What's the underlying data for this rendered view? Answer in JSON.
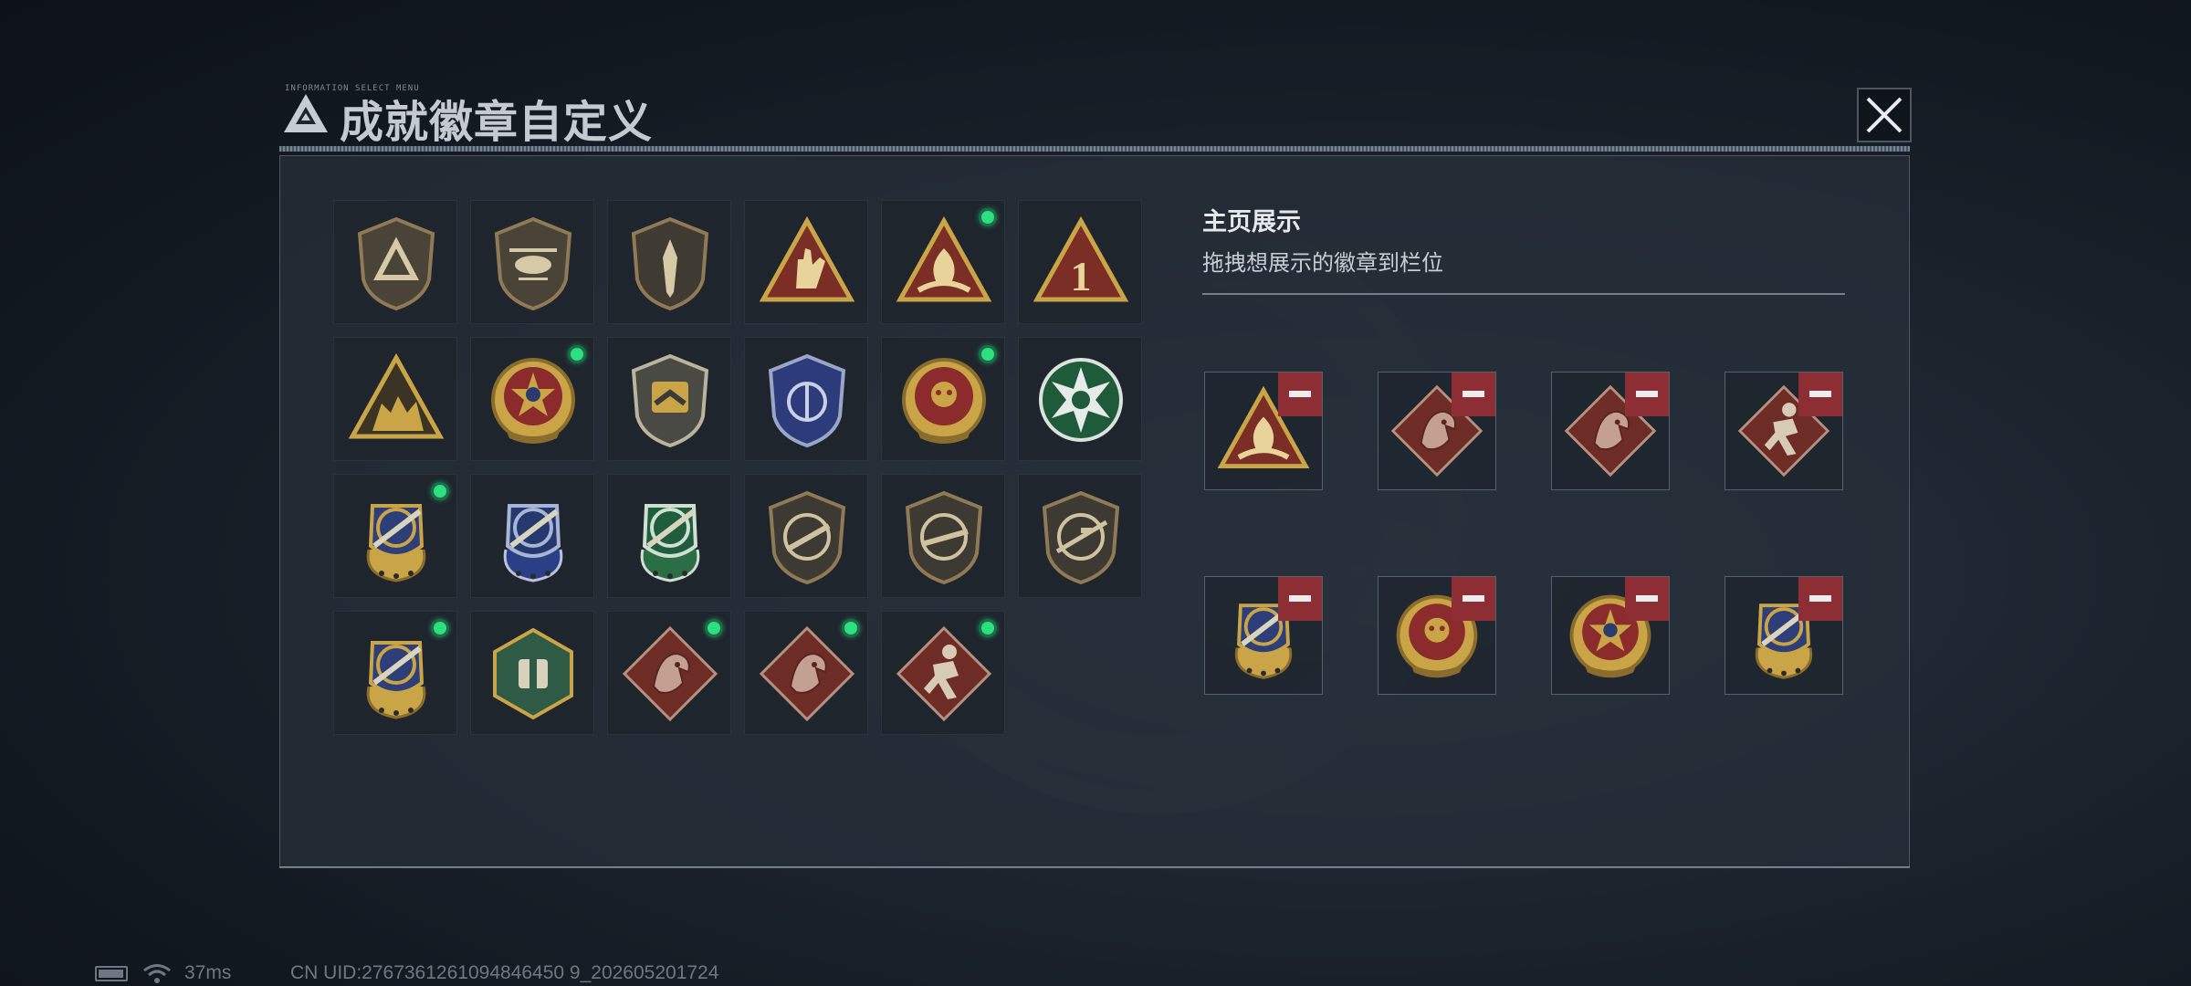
{
  "header": {
    "title": "成就徽章自定义",
    "ticker": "INFORMATION SELECT MENU",
    "close_icon": "close-x-icon"
  },
  "badge_collection": [
    {
      "name": "triangle-shield-badge",
      "new": false
    },
    {
      "name": "helicopter-shield-badge",
      "new": false
    },
    {
      "name": "dagger-shield-badge",
      "new": false
    },
    {
      "name": "hand-sign-triangle-badge",
      "new": false
    },
    {
      "name": "flame-triangle-badge",
      "new": true
    },
    {
      "name": "number-one-triangle-badge",
      "new": false
    },
    {
      "name": "soldiers-triangle-badge",
      "new": false
    },
    {
      "name": "star-wreath-badge",
      "new": true
    },
    {
      "name": "chevron-shield-badge",
      "new": false
    },
    {
      "name": "blue-crest-badge",
      "new": false
    },
    {
      "name": "skull-wreath-badge",
      "new": true
    },
    {
      "name": "green-burst-badge",
      "new": false
    },
    {
      "name": "gold-rifle-crest-badge",
      "new": true
    },
    {
      "name": "blue-rifle-crest-badge",
      "new": false
    },
    {
      "name": "green-rifle-crest-badge",
      "new": false
    },
    {
      "name": "bronze-rifle-shield-badge",
      "new": false
    },
    {
      "name": "bronze-rifle-shield-badge-2",
      "new": false
    },
    {
      "name": "bronze-sniper-shield-badge",
      "new": false
    },
    {
      "name": "gold-rifle-crest-badge-2",
      "new": true
    },
    {
      "name": "green-hexagon-badge",
      "new": false
    },
    {
      "name": "dragon-diamond-badge",
      "new": true
    },
    {
      "name": "dragon-diamond-badge-2",
      "new": true
    },
    {
      "name": "runner-diamond-badge",
      "new": true
    }
  ],
  "showcase": {
    "title": "主页展示",
    "subtitle": "拖拽想展示的徽章到栏位",
    "slots": [
      {
        "badge": "flame-triangle-badge",
        "remove_icon": "minus-icon"
      },
      {
        "badge": "dragon-diamond-badge",
        "remove_icon": "minus-icon"
      },
      {
        "badge": "dragon-diamond-badge-2",
        "remove_icon": "minus-icon"
      },
      {
        "badge": "runner-diamond-badge",
        "remove_icon": "minus-icon"
      },
      {
        "badge": "gold-rifle-crest-badge",
        "remove_icon": "minus-icon"
      },
      {
        "badge": "skull-wreath-badge",
        "remove_icon": "minus-icon"
      },
      {
        "badge": "star-wreath-badge",
        "remove_icon": "minus-icon"
      },
      {
        "badge": "gold-rifle-crest-badge-2",
        "remove_icon": "minus-icon"
      }
    ]
  },
  "status": {
    "ping": "37ms",
    "uid": "CN UID:2767361261094846450 9_202605201724"
  },
  "colors": {
    "accent_new": "#2ee081",
    "remove": "#8c2e33",
    "panel": "#262e38"
  }
}
